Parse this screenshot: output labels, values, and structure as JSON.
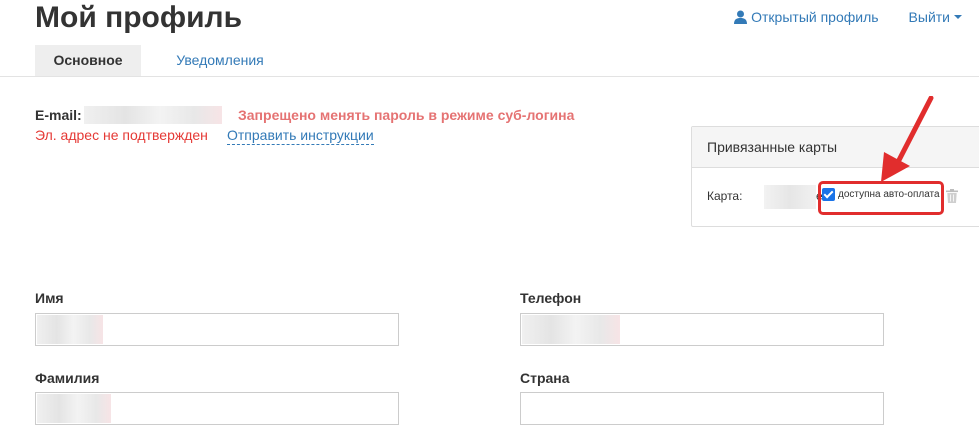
{
  "header": {
    "title": "Мой профиль",
    "profile_link": "Открытый профиль",
    "logout_link": "Выйти"
  },
  "tabs": [
    {
      "label": "Основное",
      "active": true
    },
    {
      "label": "Уведомления",
      "active": false
    }
  ],
  "email": {
    "label": "E-mail:",
    "error": "Запрещено менять пароль в режиме суб-логина",
    "unconfirmed": "Эл. адрес не подтвержден",
    "send_instructions": "Отправить инструкции"
  },
  "cards": {
    "title": "Привязанные карты",
    "card_label": "Карта:",
    "card_tail": "e",
    "autopay_label": "доступна авто-оплата",
    "autopay_checked": true
  },
  "form": {
    "first_name_label": "Имя",
    "last_name_label": "Фамилия",
    "phone_label": "Телефон",
    "country_label": "Страна"
  },
  "colors": {
    "link": "#337ab7",
    "error": "#e53935",
    "annotation": "#e12d2d"
  }
}
